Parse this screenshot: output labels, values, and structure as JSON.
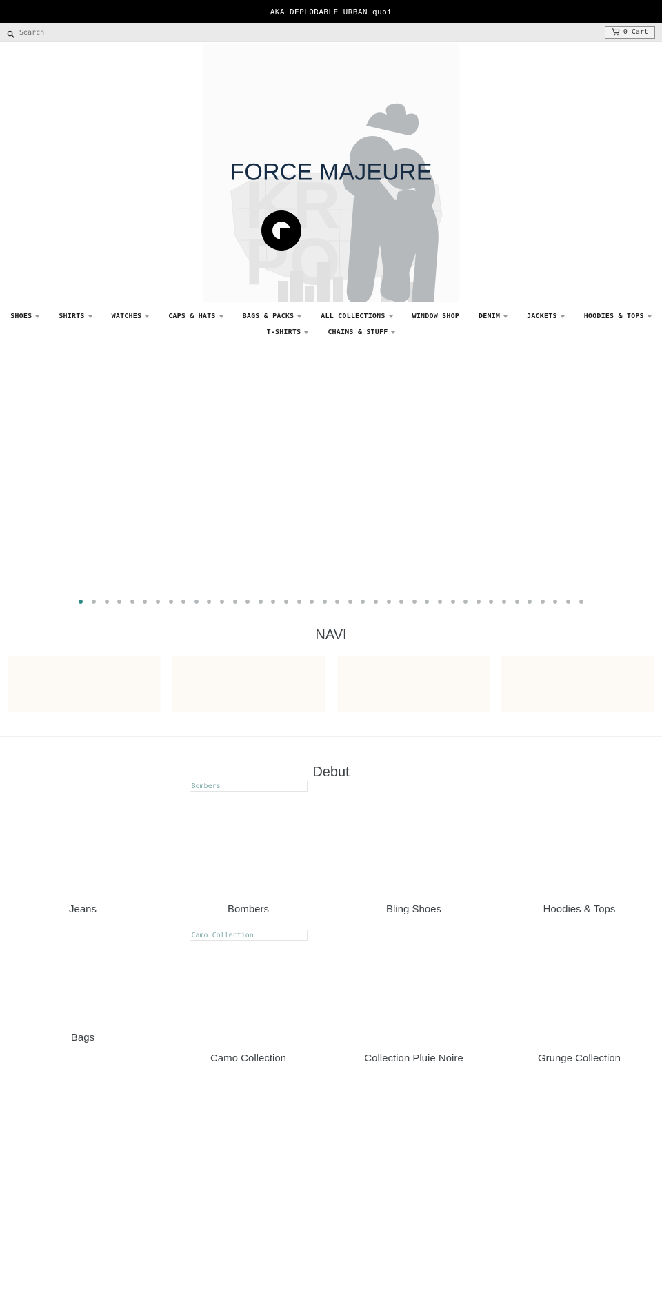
{
  "announcement": {
    "text": "AKA DEPLORABLE URBAN quoi"
  },
  "utility_bar": {
    "search": {
      "icon": "search-icon",
      "placeholder": "Search",
      "value": ""
    },
    "cart": {
      "icon": "shopping-cart-icon",
      "label": "0 Cart",
      "count": "0"
    }
  },
  "logo": {
    "wordmark": "FORCE MAJEURE",
    "wordmark_color": "#152c44",
    "background_art": "gray silhouette figures over US map outline and city skyline"
  },
  "nav": {
    "row1": [
      {
        "label": "SHOES",
        "has_dropdown": true
      },
      {
        "label": "SHIRTS",
        "has_dropdown": true
      },
      {
        "label": "WATCHES",
        "has_dropdown": true
      },
      {
        "label": "CAPS & HATS",
        "has_dropdown": true
      },
      {
        "label": "BAGS & PACKS",
        "has_dropdown": true
      },
      {
        "label": "ALL COLLECTIONS",
        "has_dropdown": true
      },
      {
        "label": "WINDOW SHOP",
        "has_dropdown": false
      },
      {
        "label": "DENIM",
        "has_dropdown": true
      },
      {
        "label": "JACKETS",
        "has_dropdown": true
      },
      {
        "label": "HOODIES & TOPS",
        "has_dropdown": true
      }
    ],
    "row2": [
      {
        "label": "T-SHIRTS",
        "has_dropdown": true
      },
      {
        "label": "CHAINS & STUFF",
        "has_dropdown": true
      }
    ]
  },
  "slideshow": {
    "total_slides": 40,
    "active_index": 0,
    "active_dot_color": "#2f8a87",
    "inactive_dot_color": "#b4b8bb"
  },
  "navi_section": {
    "title": "NAVI",
    "tiles": [
      {
        "color": "#fdfaf6"
      },
      {
        "color": "#fdfaf6"
      },
      {
        "color": "#fdfaf6"
      },
      {
        "color": "#fdfaf6"
      }
    ]
  },
  "debut_section": {
    "title": "Debut",
    "row1": [
      {
        "label": "Jeans",
        "alt_text": ""
      },
      {
        "label": "Bombers",
        "alt_text": "Bombers"
      },
      {
        "label": "Bling Shoes",
        "alt_text": ""
      },
      {
        "label": "Hoodies & Tops",
        "alt_text": ""
      }
    ],
    "row2": [
      {
        "label": "Bags",
        "alt_text": ""
      },
      {
        "label": "Camo Collection",
        "alt_text": "Camo Collection"
      },
      {
        "label": "Collection Pluie Noire",
        "alt_text": ""
      },
      {
        "label": "Grunge Collection",
        "alt_text": ""
      }
    ]
  }
}
